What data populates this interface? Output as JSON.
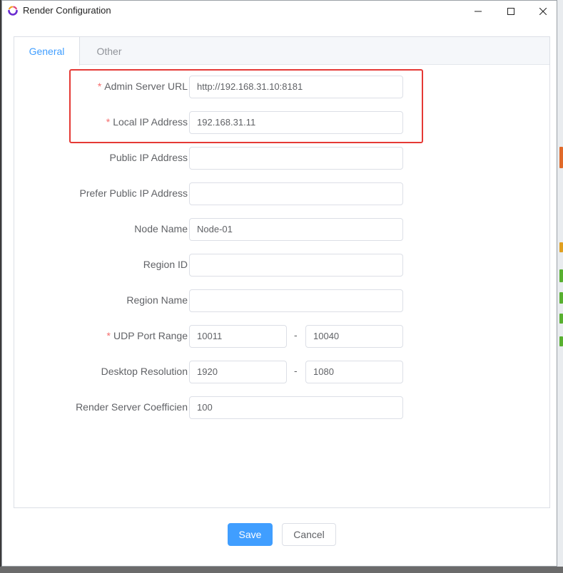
{
  "window": {
    "title": "Render Configuration"
  },
  "tabs": [
    {
      "label": "General",
      "active": true
    },
    {
      "label": "Other",
      "active": false
    }
  ],
  "form": {
    "admin_server_url": {
      "label": "Admin Server URL",
      "required": true,
      "value": "http://192.168.31.10:8181"
    },
    "local_ip": {
      "label": "Local IP Address",
      "required": true,
      "value": "192.168.31.11"
    },
    "public_ip": {
      "label": "Public IP Address",
      "required": false,
      "value": ""
    },
    "prefer_public_ip": {
      "label": "Prefer Public IP Address",
      "required": false,
      "value": ""
    },
    "node_name": {
      "label": "Node Name",
      "required": false,
      "value": "Node-01"
    },
    "region_id": {
      "label": "Region ID",
      "required": false,
      "value": ""
    },
    "region_name": {
      "label": "Region Name",
      "required": false,
      "value": ""
    },
    "udp_port_range": {
      "label": "UDP Port Range",
      "required": true,
      "from": "10011",
      "to": "10040",
      "separator": "-"
    },
    "desktop_resolution": {
      "label": "Desktop Resolution",
      "required": false,
      "width": "1920",
      "height": "1080",
      "separator": "-"
    },
    "render_coefficient": {
      "label": "Render Server Coefficien",
      "required": false,
      "value": "100"
    }
  },
  "required_marker": "*",
  "buttons": {
    "save": "Save",
    "cancel": "Cancel"
  },
  "colors": {
    "accent": "#409eff",
    "required": "#f56c6c",
    "highlight": "#e53935"
  }
}
